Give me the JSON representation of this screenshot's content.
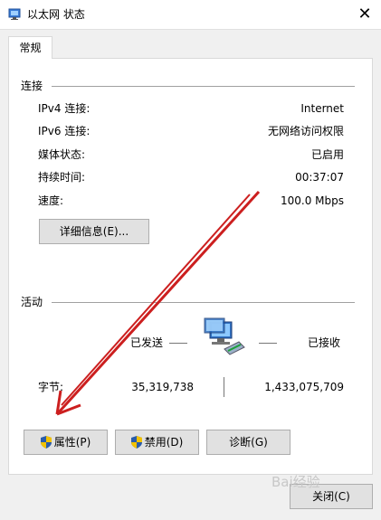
{
  "window": {
    "title": "以太网 状态",
    "close_glyph": "✕"
  },
  "tab": {
    "label": "常规"
  },
  "connection": {
    "section_title": "连接",
    "rows": [
      {
        "label": "IPv4 连接:",
        "value": "Internet"
      },
      {
        "label": "IPv6 连接:",
        "value": "无网络访问权限"
      },
      {
        "label": "媒体状态:",
        "value": "已启用"
      },
      {
        "label": "持续时间:",
        "value": "00:37:07"
      },
      {
        "label": "速度:",
        "value": "100.0 Mbps"
      }
    ],
    "details_button": "详细信息(E)..."
  },
  "activity": {
    "section_title": "活动",
    "sent_label": "已发送",
    "received_label": "已接收",
    "bytes_label": "字节:",
    "bytes_sent": "35,319,738",
    "bytes_received": "1,433,075,709"
  },
  "buttons": {
    "properties": "属性(P)",
    "disable": "禁用(D)",
    "diagnose": "诊断(G)",
    "close": "关闭(C)"
  },
  "icons": {
    "title": "network-icon",
    "activity": "network-computers-icon",
    "uac": "uac-shield-icon"
  },
  "colors": {
    "arrow": "#cc1f1f",
    "shield_blue": "#2a5caa",
    "shield_yellow": "#f2c200"
  },
  "watermark": "Bai经验"
}
